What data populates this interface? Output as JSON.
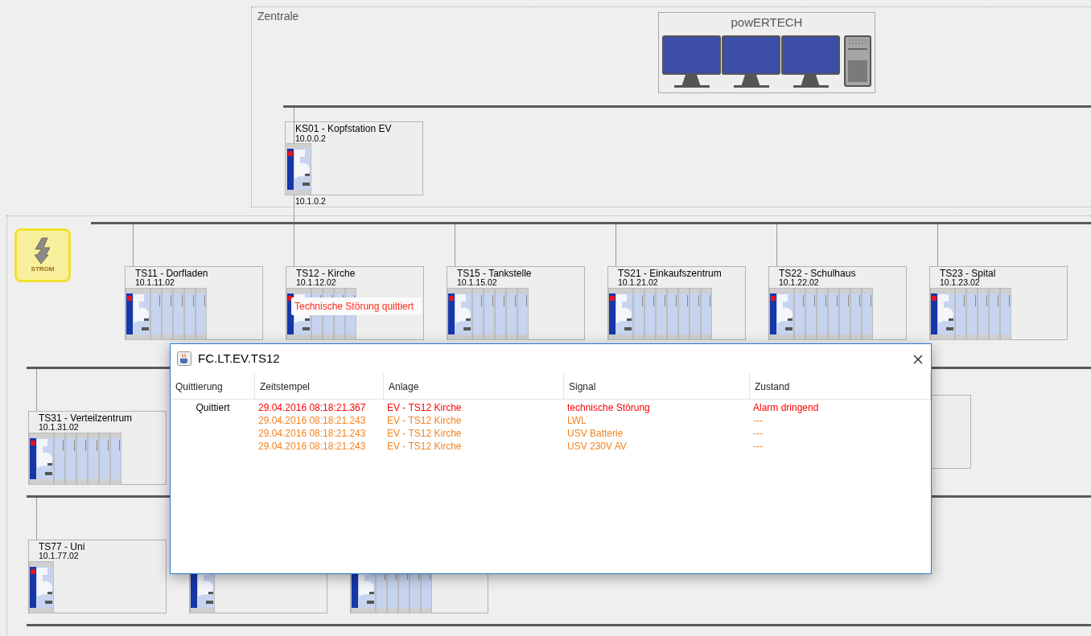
{
  "zentrale": {
    "label": "Zentrale",
    "server": {
      "title": "powERTECH"
    },
    "head_station": {
      "name": "KS01 - Kopfstation EV",
      "ip": "10.0.0.2",
      "uplink_ip": "10.1.0.2",
      "modules": [
        {
          "kind": "gateway"
        }
      ]
    }
  },
  "strom_button": {
    "label": "STROM"
  },
  "station_rows": [
    {
      "stations": [
        {
          "name": "TS11 - Dorfladen",
          "ip": "10.1.11.02",
          "modules": [
            {
              "kind": "gateway"
            },
            {
              "kind": "io"
            },
            {
              "kind": "io"
            },
            {
              "kind": "io"
            },
            {
              "kind": "io"
            },
            {
              "kind": "io"
            }
          ]
        },
        {
          "name": "TS12 - Kirche",
          "ip": "10.1.12.02",
          "tooltip": "Technische Störung quittiert",
          "modules": [
            {
              "kind": "gateway"
            },
            {
              "kind": "io"
            },
            {
              "kind": "io"
            },
            {
              "kind": "io"
            },
            {
              "kind": "io"
            }
          ]
        },
        {
          "name": "TS15 - Tankstelle",
          "ip": "10.1.15.02",
          "modules": [
            {
              "kind": "gateway"
            },
            {
              "kind": "io"
            },
            {
              "kind": "io"
            },
            {
              "kind": "io"
            },
            {
              "kind": "io"
            },
            {
              "kind": "io"
            }
          ]
        },
        {
          "name": "TS21 - Einkaufszentrum",
          "ip": "10.1.21.02",
          "modules": [
            {
              "kind": "gateway"
            },
            {
              "kind": "io"
            },
            {
              "kind": "io"
            },
            {
              "kind": "io"
            },
            {
              "kind": "io"
            },
            {
              "kind": "io"
            },
            {
              "kind": "io"
            },
            {
              "kind": "io"
            }
          ]
        },
        {
          "name": "TS22 - Schulhaus",
          "ip": "10.1.22.02",
          "modules": [
            {
              "kind": "gateway"
            },
            {
              "kind": "io"
            },
            {
              "kind": "io"
            },
            {
              "kind": "io"
            },
            {
              "kind": "io"
            },
            {
              "kind": "io"
            },
            {
              "kind": "io"
            },
            {
              "kind": "io"
            }
          ]
        },
        {
          "name": "TS23 - Spital",
          "ip": "10.1.23.02",
          "modules": [
            {
              "kind": "gateway"
            },
            {
              "kind": "io"
            },
            {
              "kind": "io"
            },
            {
              "kind": "io"
            },
            {
              "kind": "io"
            },
            {
              "kind": "io"
            }
          ]
        }
      ]
    },
    {
      "stations": [
        {
          "name": "TS31 - Verteilzentrum",
          "ip": "10.1.31.02",
          "modules": [
            {
              "kind": "gateway"
            },
            {
              "kind": "io"
            },
            {
              "kind": "io"
            },
            {
              "kind": "io"
            },
            {
              "kind": "io"
            },
            {
              "kind": "io"
            },
            {
              "kind": "io"
            }
          ]
        }
      ]
    },
    {
      "stations": [
        {
          "name": "TS77 - Uni",
          "ip": "10.1.77.02",
          "modules": [
            {
              "kind": "gateway"
            }
          ]
        },
        {
          "modules": [
            {
              "kind": "gateway"
            }
          ]
        },
        {
          "modules": [
            {
              "kind": "gateway"
            },
            {
              "kind": "io"
            },
            {
              "kind": "io"
            },
            {
              "kind": "io"
            },
            {
              "kind": "io"
            },
            {
              "kind": "io"
            }
          ]
        }
      ]
    }
  ],
  "dialog": {
    "title": "FC.LT.EV.TS12",
    "columns": [
      "Quittierung",
      "Zeitstempel",
      "Anlage",
      "Signal",
      "Zustand"
    ],
    "rows": [
      {
        "quittierung": "Quittiert",
        "zeitstempel": "29.04.2016 08:18:21.367",
        "anlage": "EV - TS12 Kirche",
        "signal": "technische Störung",
        "zustand": "Alarm dringend",
        "color": "#ff0000"
      },
      {
        "zeitstempel": "29.04.2016 08:18:21.243",
        "anlage": "EV - TS12 Kirche",
        "signal": "LWL",
        "zustand": "---",
        "color": "#f58220"
      },
      {
        "zeitstempel": "29.04.2016 08:18:21.243",
        "anlage": "EV - TS12 Kirche",
        "signal": "USV Batterie",
        "zustand": "---",
        "color": "#f58220"
      },
      {
        "zeitstempel": "29.04.2016 08:18:21.243",
        "anlage": "EV - TS12 Kirche",
        "signal": "USV 230V AV",
        "zustand": "---",
        "color": "#f58220"
      }
    ]
  }
}
